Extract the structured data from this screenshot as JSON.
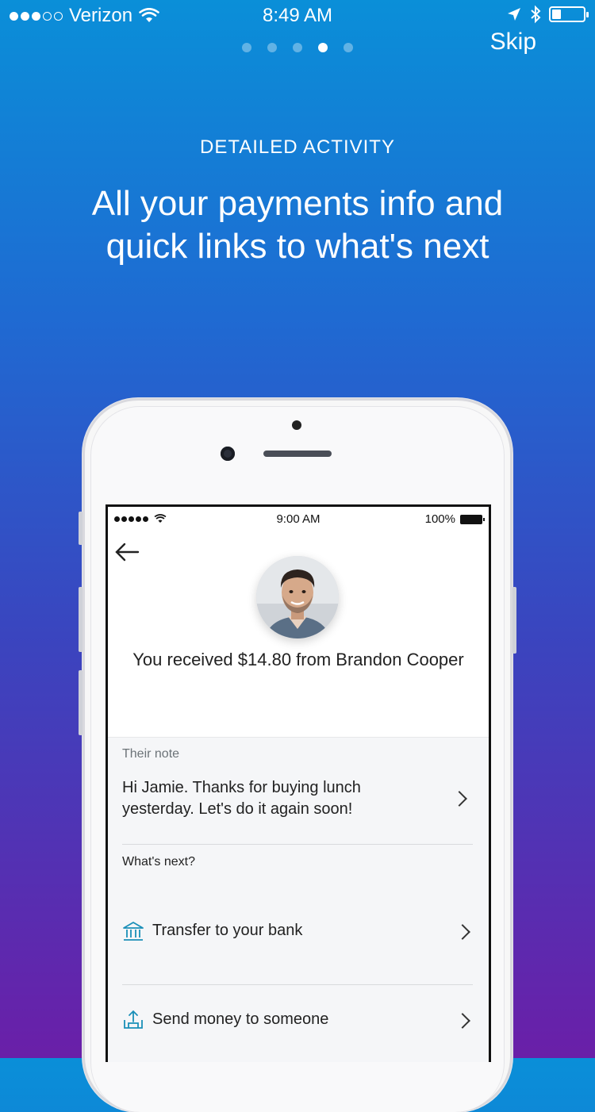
{
  "status_bar": {
    "carrier": "Verizon",
    "time": "8:49 AM",
    "battery_level": 0.3
  },
  "onboarding": {
    "skip_label": "Skip",
    "page_count": 5,
    "current_page": 4,
    "eyebrow": "DETAILED ACTIVITY",
    "headline": "All your payments info and quick links to what's next"
  },
  "mock_screen": {
    "status": {
      "time": "9:00 AM",
      "battery": "100%"
    },
    "title": "You received $14.80 from Brandon Cooper",
    "note_label": "Their note",
    "note_text": "Hi Jamie. Thanks for buying lunch yesterday. Let's do it again soon!",
    "whats_next_label": "What's next?",
    "actions": [
      {
        "label": "Transfer to your bank",
        "icon": "bank-icon"
      },
      {
        "label": "Send money to someone",
        "icon": "send-money-icon"
      }
    ]
  },
  "colors": {
    "gradient_top": "#0a8fd8",
    "gradient_bottom": "#6a1fa8",
    "icon_accent": "#1a8fb8"
  }
}
